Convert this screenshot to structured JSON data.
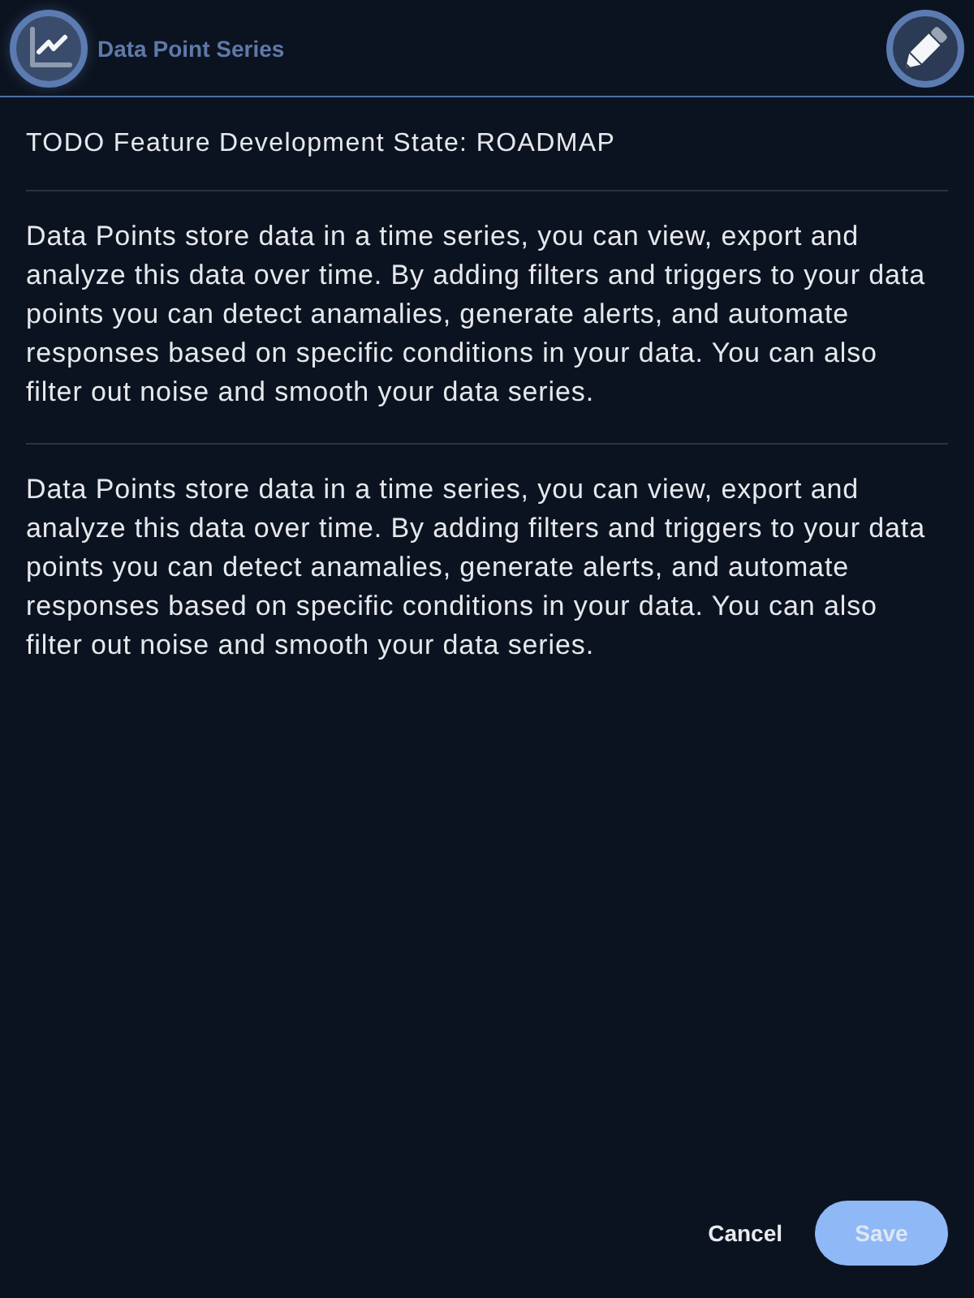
{
  "header": {
    "title": "Data Point Series"
  },
  "status_line": "TODO Feature Development State: ROADMAP",
  "paragraphs": [
    "Data Points store data in a time series, you can view, export and analyze this data over time. By adding filters and triggers to your data points you can detect anamalies, generate alerts, and automate responses based on specific conditions in your data. You can also filter out noise and smooth your data series.",
    "Data Points store data in a time series, you can view, export and analyze this data over time. By adding filters and triggers to your data points you can detect anamalies, generate alerts, and automate responses based on specific conditions in your data. You can also filter out noise and smooth your data series."
  ],
  "buttons": [
    {
      "label": "Cancel",
      "kind": "text",
      "disabled": false
    },
    {
      "label": "Save",
      "kind": "primary",
      "disabled": true
    }
  ]
}
